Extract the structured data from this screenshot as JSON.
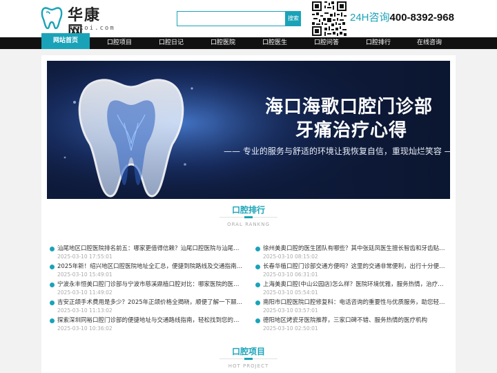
{
  "header": {
    "logo_name": "华康网",
    "logo_domain": "hckoi.com",
    "search_placeholder": "",
    "search_button": "搜索",
    "hotline_label": "24H咨询",
    "hotline_number": "400-8392-968"
  },
  "nav": {
    "home": "网站首页",
    "items": [
      "口腔项目",
      "口腔日记",
      "口腔医院",
      "口腔医生",
      "口腔问答",
      "口腔排行",
      "在线咨询"
    ]
  },
  "banner": {
    "title": "海口海歌口腔门诊部",
    "subtitle": "牙痛治疗心得",
    "slogan": "—— 专业的服务与舒适的环境让我恢复自信，重现灿烂笑容 ——"
  },
  "ranking": {
    "title": "口腔排行",
    "subtitle": "ORAL RANKNG",
    "left": [
      {
        "title": "汕尾地区口腔医院排名前五：哪家更值得信赖？汕尾口腔医院与汕尾市爱...",
        "date": "2025-03-10 17:55:01"
      },
      {
        "title": "2025年新！绍兴地区口腔医院地址全汇总，便捷到院路线及交通指南，让...",
        "date": "2025-03-10 15:49:01"
      },
      {
        "title": "宁波永丰恒美口腔门诊部与宁波市慈溪鼎植口腔对比：哪家医院的医生团...",
        "date": "2025-03-10 11:49:02"
      },
      {
        "title": "吉安正颌手术费用是多少？2025年正颌价格全揭晓，顺便了解一下颞牙槽...",
        "date": "2025-03-10 11:13:02"
      },
      {
        "title": "探索深圳同裕口腔门诊部的便捷地址与交通路线指南，轻松找到您的健康...",
        "date": "2025-03-10 10:36:02"
      }
    ],
    "right": [
      {
        "title": "徐州美奥口腔的医生团队有哪些？其中张廷凤医生擅长智齿和牙齿贴片，...",
        "date": "2025-03-10 08:15:02"
      },
      {
        "title": "长春华植口腔门诊部交通方便吗？这里的交通非常便利，出行十分便捷，...",
        "date": "2025-03-10 06:31:01"
      },
      {
        "title": "上海美奥口腔(中山公园店)怎么样？医院环境优雅，服务热情，治疗结果...",
        "date": "2025-03-10 05:54:01"
      },
      {
        "title": "南阳市口腔医院口腔修复科：电话咨询的重要性与优质服务，助您轻松...",
        "date": "2025-03-10 03:57:01"
      },
      {
        "title": "德阳地区烤瓷牙医院推荐，三家口碑不错、服务热情的医疗机构",
        "date": "2025-03-10 02:50:01"
      }
    ]
  },
  "project": {
    "title": "口腔项目",
    "subtitle": "HOT PROJECT"
  },
  "colors": {
    "accent": "#1aa3b8",
    "nav_bg": "#111111",
    "banner_bg": "#0e1a3a"
  }
}
